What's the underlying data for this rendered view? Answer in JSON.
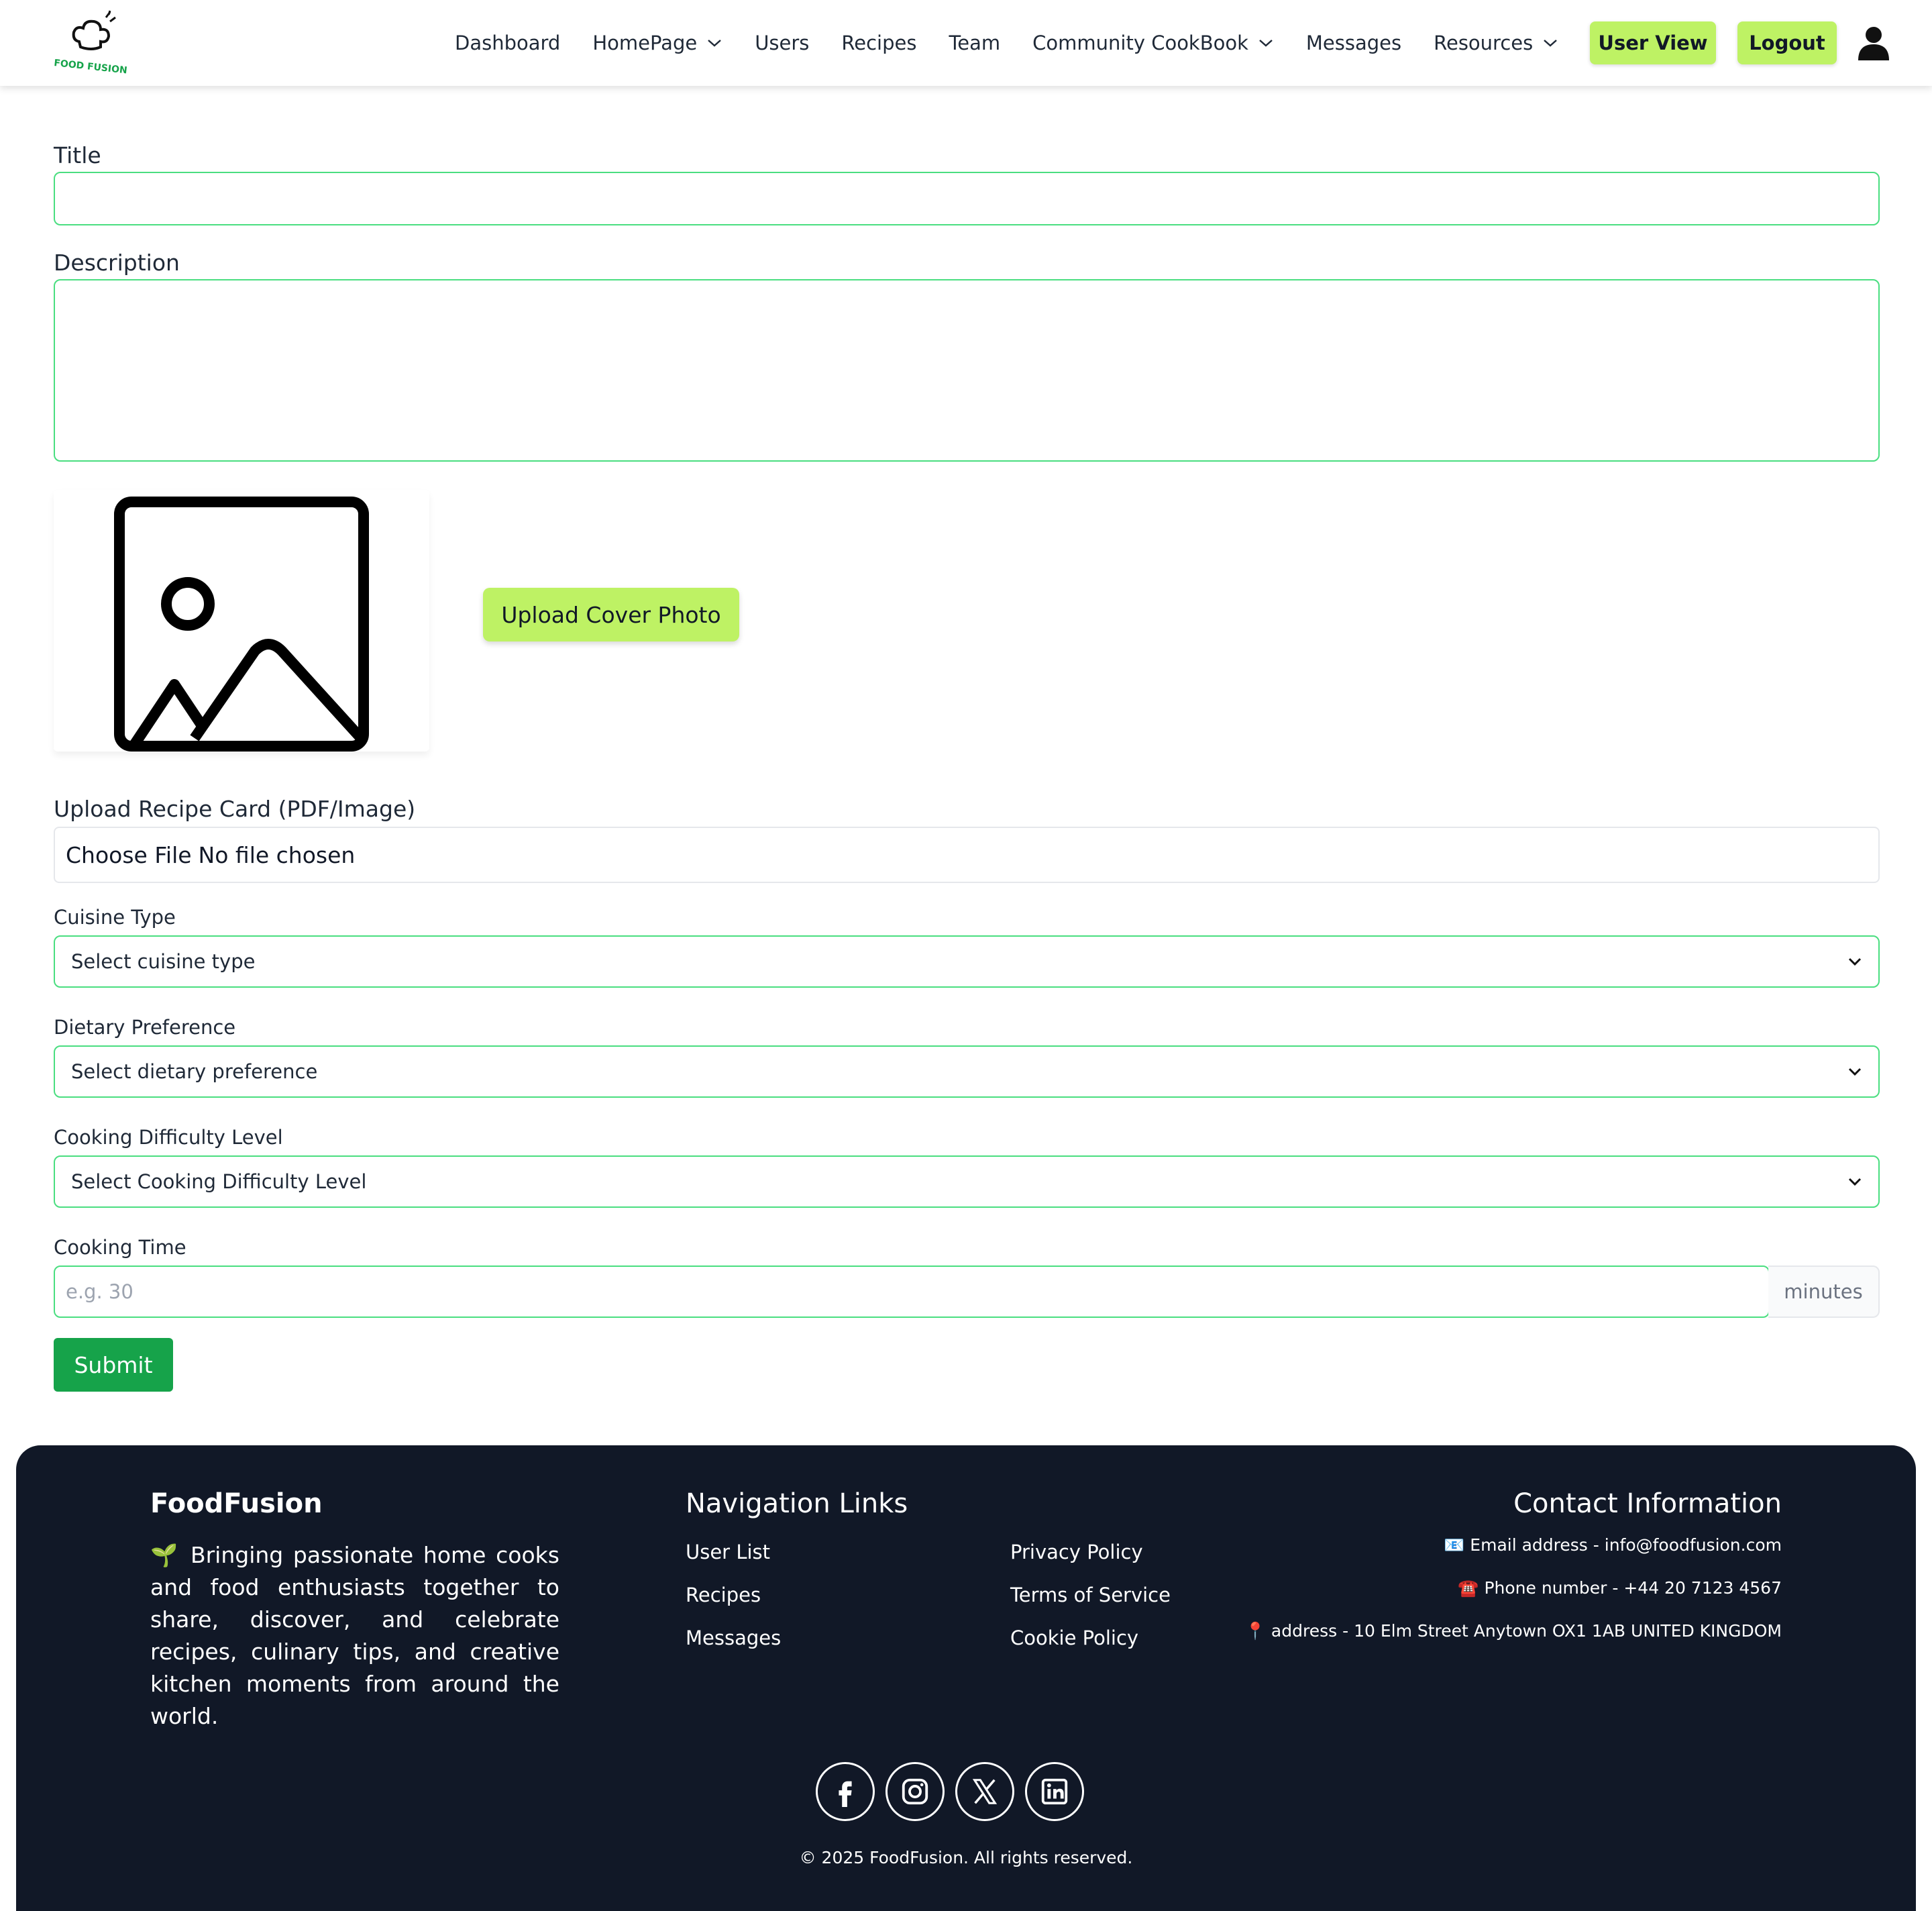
{
  "navbar": {
    "logo_text": "FOOD FUSION",
    "links": [
      {
        "label": "Dashboard",
        "dropdown": false
      },
      {
        "label": "HomePage",
        "dropdown": true
      },
      {
        "label": "Users",
        "dropdown": false
      },
      {
        "label": "Recipes",
        "dropdown": false
      },
      {
        "label": "Team",
        "dropdown": false
      },
      {
        "label": "Community CookBook",
        "dropdown": true
      },
      {
        "label": "Messages",
        "dropdown": false
      },
      {
        "label": "Resources",
        "dropdown": true
      }
    ],
    "user_view_label": "User View",
    "logout_label": "Logout",
    "profile_icon": "user-icon"
  },
  "form": {
    "title_label": "Title",
    "title_value": "",
    "description_label": "Description",
    "description_value": "",
    "cover_placeholder_icon": "image-icon",
    "upload_cover_label": "Upload Cover Photo",
    "recipe_card_label": "Upload Recipe Card (PDF/Image)",
    "choose_file_label": "Choose File",
    "no_file_label": "No file chosen",
    "cuisine_label": "Cuisine Type",
    "cuisine_selected": "Select cuisine type",
    "dietary_label": "Dietary Preference",
    "dietary_selected": "Select dietary preference",
    "difficulty_label": "Cooking Difficulty Level",
    "difficulty_selected": "Select Cooking Difficulty Level",
    "cooking_time_label": "Cooking Time",
    "cooking_time_placeholder": "e.g. 30",
    "cooking_time_unit": "minutes",
    "submit_label": "Submit"
  },
  "footer": {
    "brand_title": "FoodFusion",
    "brand_description": "🌱 Bringing passionate home cooks and food enthusiasts together to share, discover, and celebrate recipes, culinary tips, and creative kitchen moments from around the world.",
    "nav_title": "Navigation Links",
    "nav_col1": [
      "User List",
      "Recipes",
      "Messages"
    ],
    "nav_col2": [
      "Privacy Policy",
      "Terms of Service",
      "Cookie Policy"
    ],
    "contact_title": "Contact Information",
    "contact_email": "📧 Email address - info@foodfusion.com",
    "contact_phone": "☎️ Phone number - +44 20 7123 4567",
    "contact_address": "📍 address - 10 Elm Street Anytown OX1 1AB UNITED KINGDOM",
    "socials": [
      "facebook-icon",
      "instagram-icon",
      "x-twitter-icon",
      "linkedin-icon"
    ],
    "copyright": "© 2025 FoodFusion. All rights reserved."
  },
  "colors": {
    "accent_lime": "#bef264",
    "field_border": "#4ade80",
    "submit_green": "#16a34a",
    "footer_bg": "#111827"
  }
}
